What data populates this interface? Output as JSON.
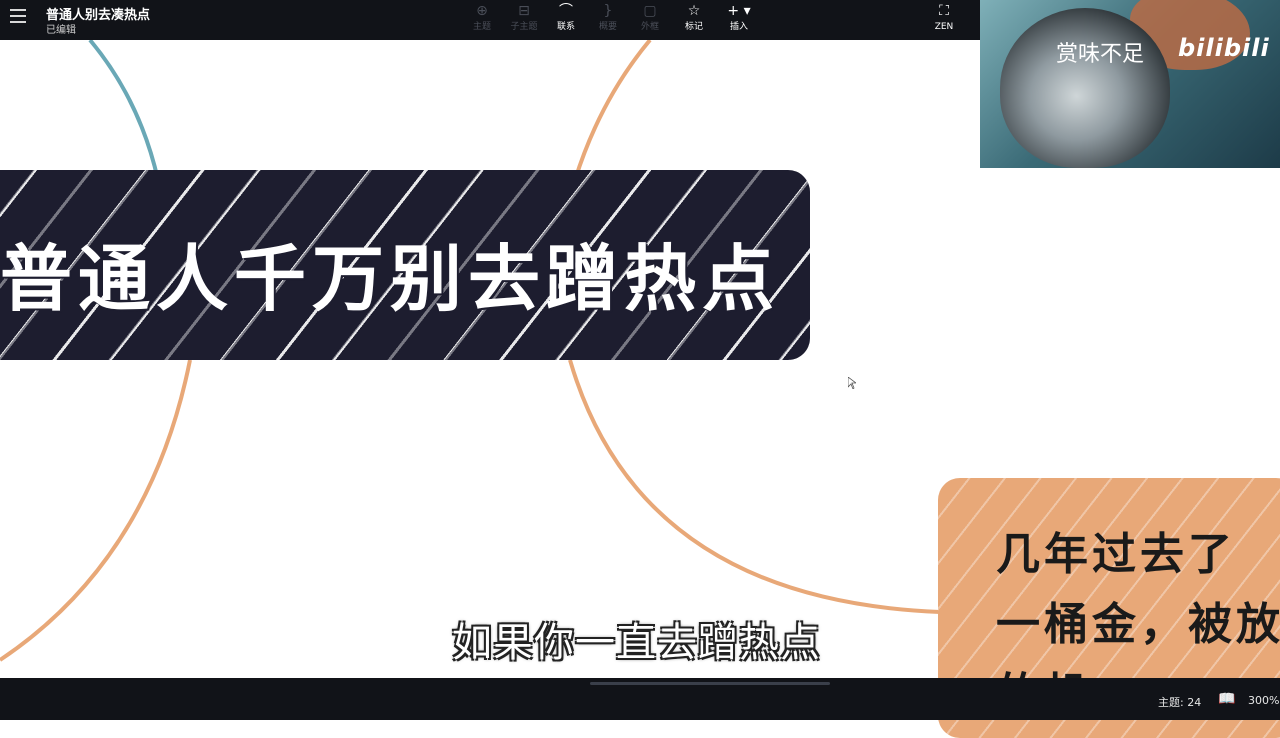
{
  "document": {
    "title": "普通人别去凑热点",
    "status": "已编辑"
  },
  "toolbar": {
    "tools": [
      {
        "label": "主题",
        "icon": "topic-icon",
        "enabled": false
      },
      {
        "label": "子主题",
        "icon": "subtopic-icon",
        "enabled": false
      },
      {
        "label": "联系",
        "icon": "relationship-icon",
        "enabled": true
      },
      {
        "label": "概要",
        "icon": "summary-icon",
        "enabled": false
      },
      {
        "label": "外框",
        "icon": "boundary-icon",
        "enabled": false
      },
      {
        "label": "标记",
        "icon": "star-icon",
        "enabled": true
      },
      {
        "label": "插入",
        "icon": "plus-icon",
        "enabled": true
      }
    ],
    "zen_label": "ZEN"
  },
  "webcam": {
    "caption": "赏味不足",
    "brand": "bilibili"
  },
  "mindmap": {
    "central_topic": "普通人千万别去蹭热点",
    "sub_topic_lines": [
      "几年过去了",
      "一桶金，被放",
      "的机"
    ]
  },
  "video_subtitle": "如果你一直去蹭热点",
  "statusbar": {
    "topic_count": "主题: 24",
    "zoom": "300%"
  },
  "colors": {
    "toolbar_bg": "#111318",
    "central_node": "#1d1d2f",
    "sub_node": "#e8a878",
    "branch_teal": "#6aa8b6",
    "branch_orange": "#e8a878"
  }
}
